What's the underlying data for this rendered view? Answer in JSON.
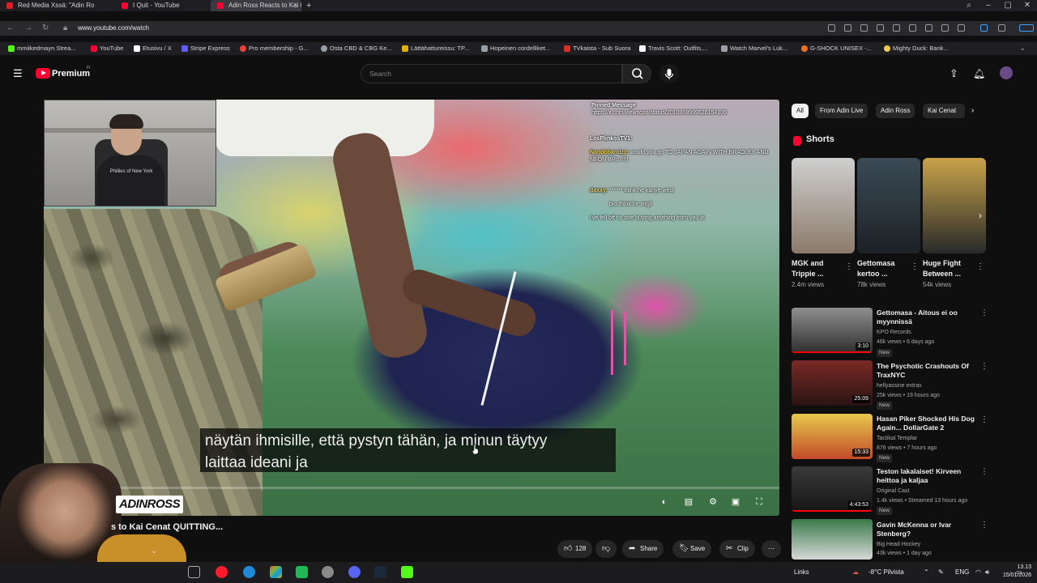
{
  "browser": {
    "tabs": [
      {
        "title": "Red Media Xssä: \"Adin Ro",
        "favicon_color": "#e11d2a"
      },
      {
        "title": "I Quit - YouTube",
        "favicon_color": "#ff0033"
      },
      {
        "title": "Adin Ross Reacts to Kai C",
        "favicon_color": "#ff0033"
      }
    ],
    "new_tab": "+",
    "window_controls": [
      "search-icon",
      "minimize",
      "maximize",
      "close"
    ],
    "url": "www.youtube.com/watch",
    "bookmarks": [
      {
        "label": "mmiikedmayn Strea...",
        "color": "#53fc18"
      },
      {
        "label": "YouTube",
        "color": "#ff0033"
      },
      {
        "label": "Etusivu / X",
        "color": "#ffffff"
      },
      {
        "label": "Stripe Express",
        "color": "#635bff"
      },
      {
        "label": "Pro membership - G...",
        "color": "#ea4335"
      },
      {
        "label": "Osta CBD & CBG Ke...",
        "color": "#9aa0a6"
      },
      {
        "label": "Lättähattureissu: TP...",
        "color": "#e0b000"
      },
      {
        "label": "Hopeinen cordelliket...",
        "color": "#9aa0a6"
      },
      {
        "label": "TVkaista - Sub Suora",
        "color": "#d93025"
      },
      {
        "label": "Travis Scott: Outfits,...",
        "color": "#ffffff"
      },
      {
        "label": "Watch Marvel's Luk...",
        "color": "#9aa0a6"
      },
      {
        "label": "G-SHOCK UNISEX -...",
        "color": "#f47216"
      },
      {
        "label": "Mighty Duck: Bank...",
        "color": "#f2c94c"
      }
    ]
  },
  "youtube": {
    "brand": "Premium",
    "country": "FI",
    "search_placeholder": "Search",
    "video": {
      "title": "s to Kai Cenat QUITTING...",
      "subtitle_lines": [
        "näytän ihmisille, että pystyn tähän, ja minun täytyy",
        "laittaa ideani ja"
      ],
      "overlay_logo": "ADINROSS",
      "webcam_shirt_text": "Phillies of New York",
      "likes": "128",
      "share": "Share",
      "save": "Save",
      "clip": "Clip",
      "progress": 0.0
    },
    "chat": {
      "pinned_label": "Pinned Message",
      "pinned_url": "https://x.com/viewscoo/status/2010908999626154106",
      "messages": [
        {
          "user": "LosPlinkosTV1:",
          "text": "",
          "color": "#ffffff"
        },
        {
          "user": "Nandobandzz:",
          "text": "would you go TO JAPAN AGAIN WITH BRADLEY AND NEON BRo !!!!!",
          "color": "#f1d35a"
        },
        {
          "user": "daxxy:",
          "text": "****** think he kanye west",
          "color": "#ffffff"
        },
        {
          "user": "",
          "text": "bro think he virgil",
          "color": "#ffffff"
        },
        {
          "user": "",
          "text": "i've fell off no one buying anything from you in",
          "color": "#ffffff"
        }
      ]
    },
    "chips": [
      {
        "label": "All",
        "active": true
      },
      {
        "label": "From Adin Live",
        "active": false
      },
      {
        "label": "Adin Ross",
        "active": false
      },
      {
        "label": "Kai Cenat",
        "active": false
      }
    ],
    "shorts_heading": "Shorts",
    "shorts": [
      {
        "title": "MGK and Trippie ...",
        "views": "2.4m views",
        "colors": [
          "#cfcfcf",
          "#8b7a6a"
        ]
      },
      {
        "title": "Gettomasa kertoo ...",
        "views": "78k views",
        "colors": [
          "#3b4a55",
          "#1c2226"
        ]
      },
      {
        "title": "Huge Fight Between ...",
        "views": "54k views",
        "colors": [
          "#c9a34a",
          "#2a2a2a"
        ]
      }
    ],
    "related": [
      {
        "title": "Gettomasa - Aitous ei oo myynnissä",
        "channel": "KPO Records",
        "meta": "46k views • 6 days ago",
        "duration": "3:10",
        "badge": "New",
        "colors": [
          "#8f8f8f",
          "#2e2e2e"
        ]
      },
      {
        "title": "The Psychotic Crashouts Of TraxNYC",
        "channel": "hellyassine extras",
        "meta": "25k views • 19 hours ago",
        "duration": "25:09",
        "badge": "New",
        "colors": [
          "#7a2a26",
          "#2a1413"
        ]
      },
      {
        "title": "Hasan Piker Shocked His Dog Again... DollarGate 2",
        "channel": "Tactikal Templar",
        "meta": "876 views • 7 hours ago",
        "duration": "15:33",
        "badge": "New",
        "colors": [
          "#e7c84c",
          "#c24a2a"
        ]
      },
      {
        "title": "Teston lakalaiset! Kirveen heittoa ja kaljaa",
        "channel": "Original Cast",
        "meta": "1.4k views • Streamed 13 hours ago",
        "duration": "4:43:53",
        "badge": "New",
        "colors": [
          "#3a3a3a",
          "#151515"
        ]
      },
      {
        "title": "Gavin McKenna or Ivar Stenberg?",
        "channel": "Big Head Hockey",
        "meta": "43k views • 1 day ago",
        "duration": "",
        "badge": "",
        "colors": [
          "#3a7a4a",
          "#d8d8d8"
        ]
      }
    ]
  },
  "taskbar": {
    "links": "Links",
    "weather": "-8°C Pilvista",
    "language": "ENG",
    "time": "13.13",
    "date": "15/01/2026"
  }
}
